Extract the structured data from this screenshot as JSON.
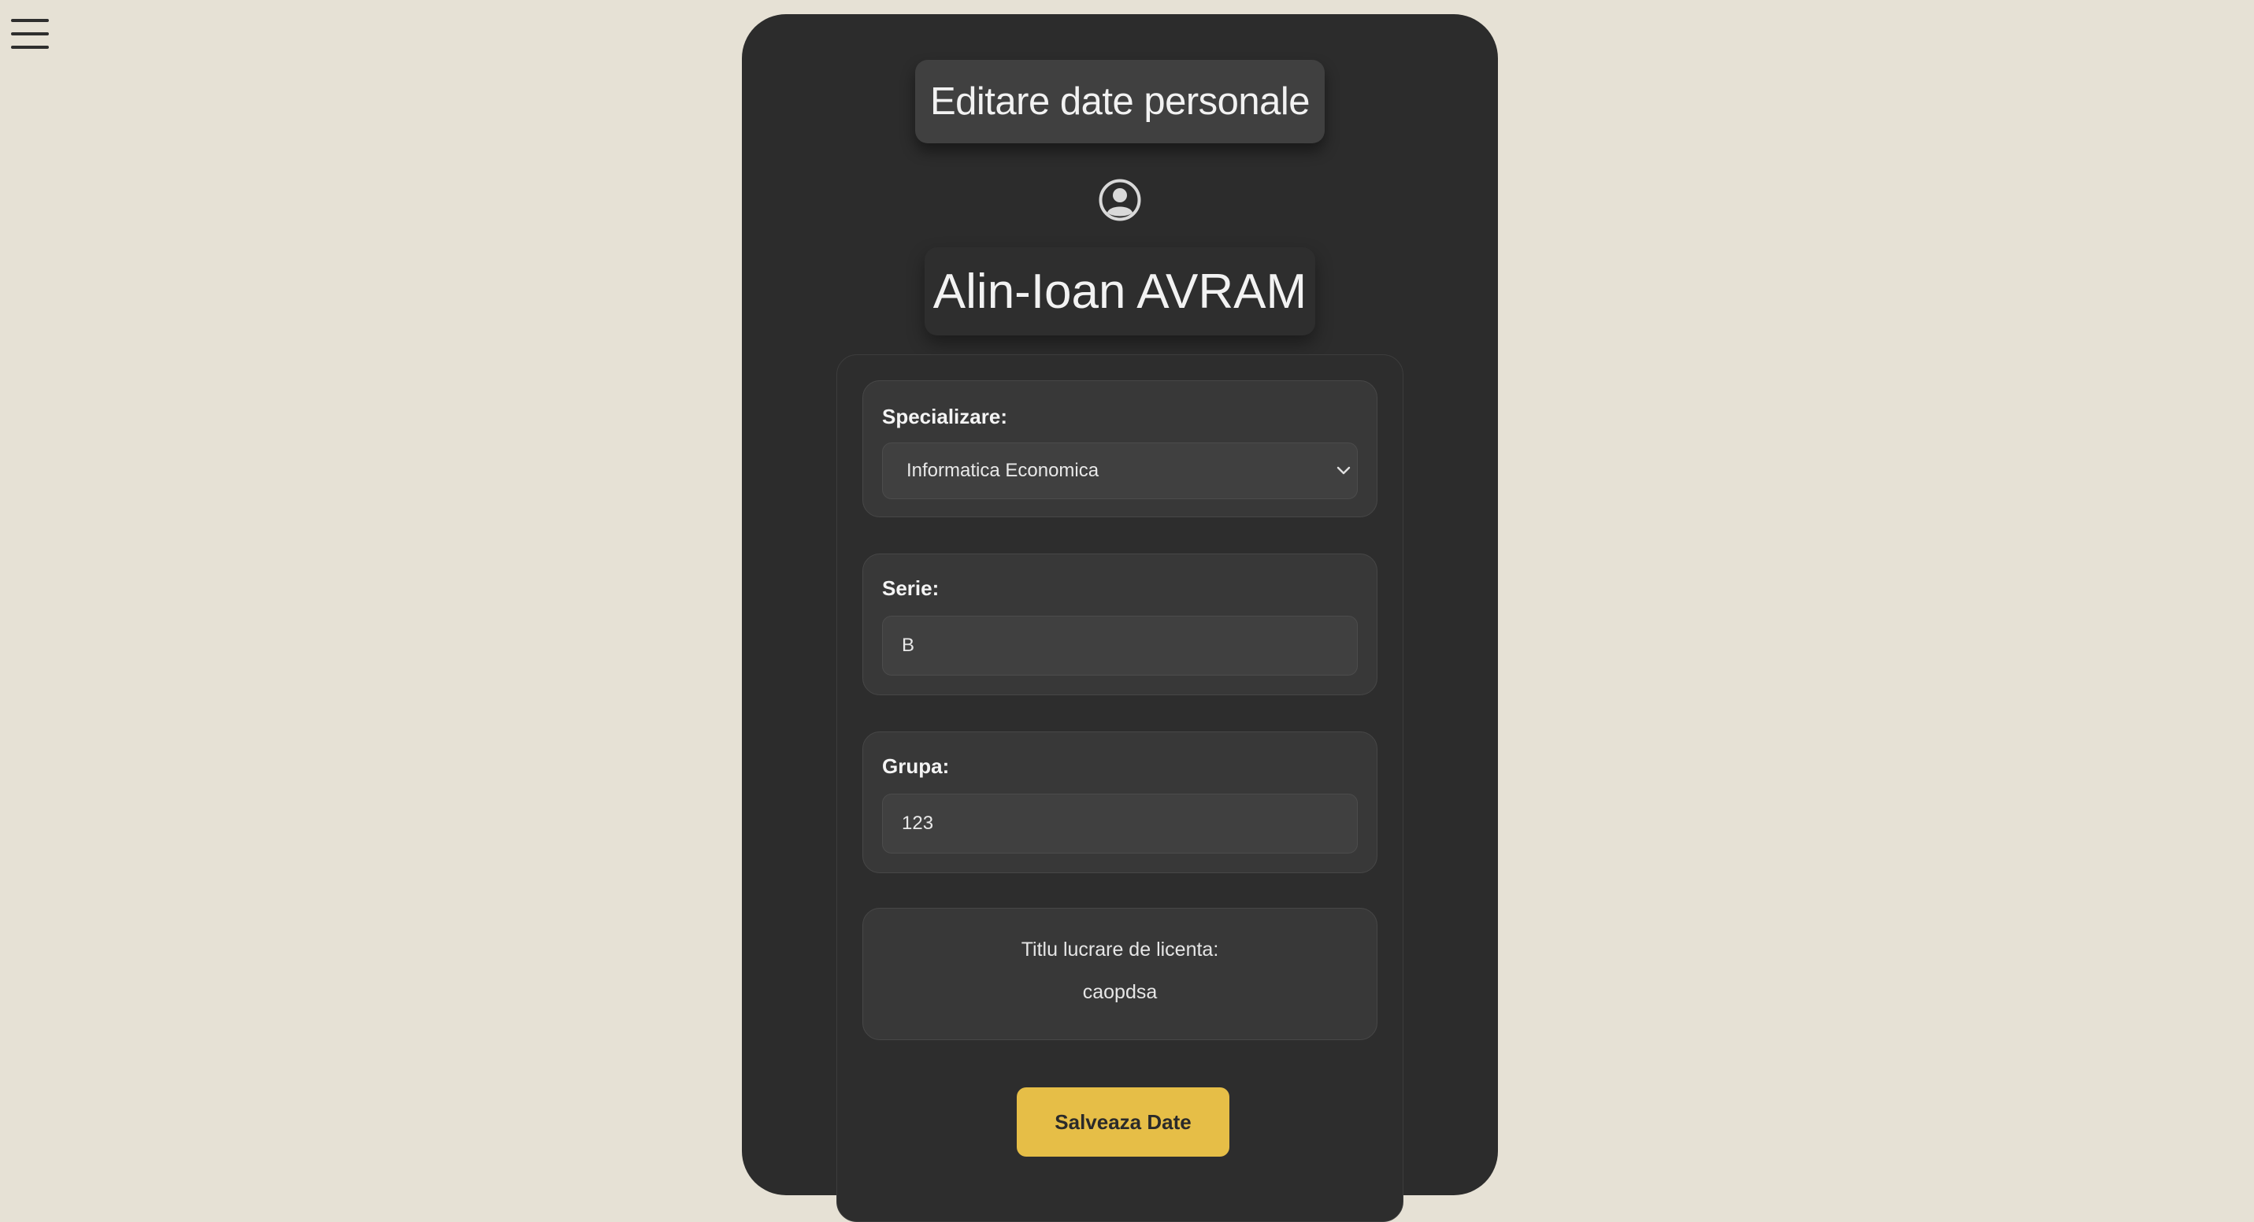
{
  "nav": {
    "menu_icon": "hamburger-menu-icon"
  },
  "header": {
    "title": "Editare date personale",
    "avatar_icon": "user-circle-icon",
    "student_name": "Alin-Ioan AVRAM"
  },
  "form": {
    "specializare": {
      "label": "Specializare:",
      "selected": "Informatica Economica",
      "icon": "chevron-down-icon"
    },
    "serie": {
      "label": "Serie:",
      "value": "B"
    },
    "grupa": {
      "label": "Grupa:",
      "value": "123"
    },
    "thesis": {
      "label": "Titlu lucrare de licenta:",
      "value": "caopdsa"
    },
    "save_label": "Salveaza Date"
  },
  "colors": {
    "page_background": "#e6e1d5",
    "panel_background": "#2c2c2c",
    "accent_button": "#e6be47"
  }
}
